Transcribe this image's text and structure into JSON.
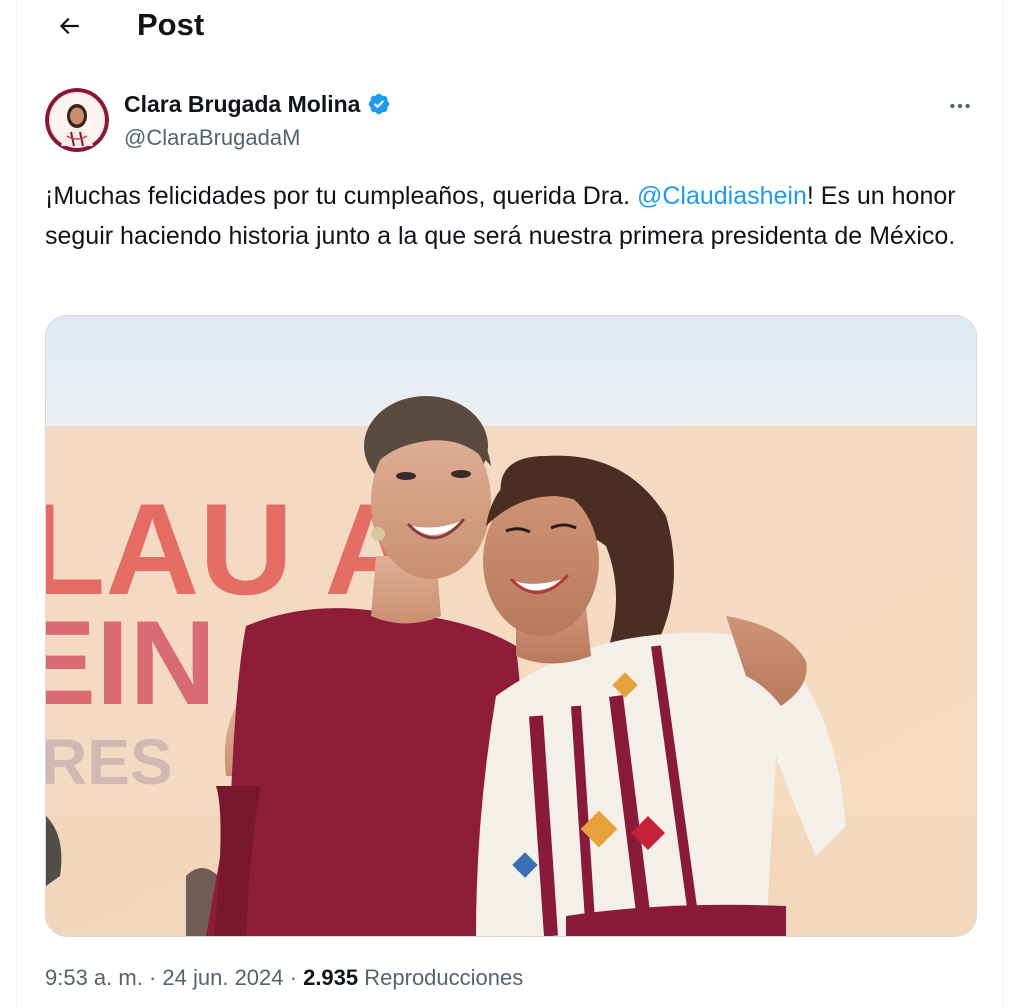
{
  "header": {
    "back_icon": "arrow-left-icon",
    "title": "Post"
  },
  "author": {
    "name": "Clara Brugada Molina",
    "handle": "@ClaraBrugadaM",
    "verified_icon": "verified-badge-icon",
    "verified_color": "#1d9bf0"
  },
  "more_icon": "more-horizontal-icon",
  "tweet": {
    "text_before": "¡Muchas felicidades por tu cumpleaños, querida Dra. ",
    "mention": "@Claudiashein",
    "text_after": "! Es un honor seguir haciendo historia junto a la que será nuestra primera presidenta de México."
  },
  "media": {
    "banner_text_line1": "LAU  A",
    "banner_text_line2": "EIN",
    "banner_text_line3": "RES"
  },
  "meta": {
    "time": "9:53 a. m.",
    "sep1": " · ",
    "date": "24 jun. 2024",
    "sep2": " · ",
    "views": "2.935",
    "views_label": " Reproducciones"
  },
  "colors": {
    "accent": "#1d9bf0",
    "text": "#0f1419",
    "secondary": "#536471",
    "border": "#eff3f4"
  }
}
